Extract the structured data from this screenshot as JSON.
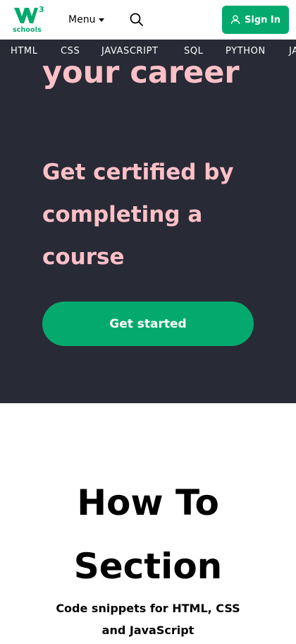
{
  "header": {
    "logo": {
      "mark": "W",
      "superscript": "3",
      "wordmark": "schools",
      "color": "#04AA6D"
    },
    "menu_label": "Menu",
    "search_icon": "search-icon",
    "signin_label": "Sign In",
    "signin_icon": "user-icon",
    "accent": "#04AA6D"
  },
  "nav": {
    "items": [
      "HTML",
      "CSS",
      "JAVASCRIPT",
      "SQL",
      "PYTHON",
      "JAVA"
    ],
    "background": "#282A35"
  },
  "hero": {
    "headline_partial": "your career",
    "subheading": "Get certified by completing a course",
    "cta_label": "Get started",
    "text_color": "#FFC0C7",
    "cta_color": "#04AA6D"
  },
  "howto": {
    "title": "How To Section",
    "subtitle": "Code snippets for HTML, CSS and JavaScript"
  }
}
